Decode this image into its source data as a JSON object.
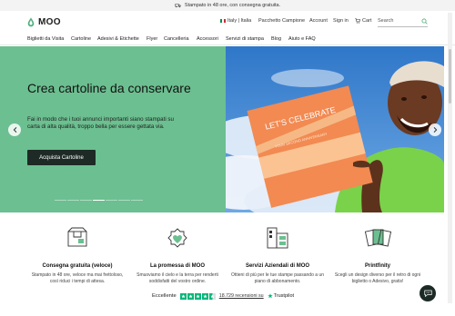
{
  "promo": {
    "text": "Stampato in 48 ore, con consegna gratuita."
  },
  "brand": {
    "name": "MOO"
  },
  "utility": {
    "country": "Italy | Italia",
    "sample_pack": "Pacchetto Campione",
    "account": "Account",
    "signin": "Sign in",
    "cart": "Cart",
    "search_placeholder": "Search"
  },
  "nav": [
    "Biglietti da Visita",
    "Cartoline",
    "Adesivi & Etichette",
    "Flyer",
    "Cancelleria",
    "Accessori",
    "Servizi di stampa",
    "Blog",
    "Aiuto e FAQ"
  ],
  "hero": {
    "title": "Crea cartoline da conservare",
    "text": "Fai in modo che i tuoi annunci importanti siano stampati su carta di alta qualità, troppo bella per essere gettata via.",
    "cta": "Acquista Cartoline",
    "card_text": "LET'S CELEBRATE",
    "card_sub": "YOUR SECOND ANNIVERSARY"
  },
  "features": [
    {
      "icon": "delivery-box-icon",
      "title": "Consegna gratuita (veloce)",
      "text": "Stampato in 48 ore, veloce ma mai frettoloso, così riduci i tempi di attesa."
    },
    {
      "icon": "heart-badge-icon",
      "title": "La promessa di MOO",
      "text": "Smuoviamo il cielo e la terra per renderti soddisfatti del vostro ordine."
    },
    {
      "icon": "building-icon",
      "title": "Servizi Aziendali di MOO",
      "text": "Ottieni di più per le tue stampe passando a un piano di abbonamento."
    },
    {
      "icon": "cards-icon",
      "title": "Printfinity",
      "text": "Scegli un design diverso per il retro di ogni biglietto o Adesivo, gratis!"
    }
  ],
  "trust": {
    "label": "Eccellente",
    "reviews": "18.729 recensioni su",
    "brand": "Trustpilot",
    "rating_stars": 4.5
  },
  "colors": {
    "hero_green": "#6cbf90",
    "button_dark": "#1e2a26",
    "trustpilot_green": "#00b67a"
  }
}
